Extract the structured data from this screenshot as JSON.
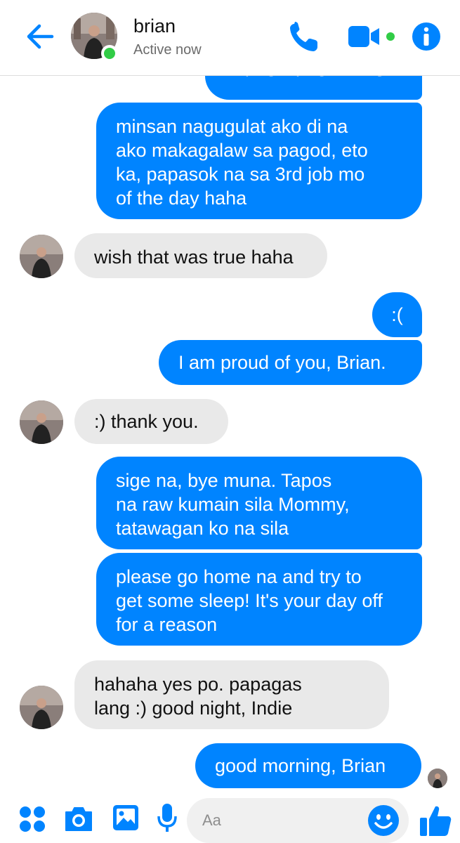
{
  "header": {
    "contact_name": "brian",
    "status": "Active now"
  },
  "messages": [
    {
      "from": "me",
      "text": "sipag sipag mo nga"
    },
    {
      "from": "me",
      "text": "minsan nagugulat ako di na\nako makagalaw sa pagod, eto\nka, papasok na sa 3rd job mo\nof the day haha"
    },
    {
      "from": "brian",
      "text": "wish that was true haha"
    },
    {
      "from": "me",
      "text": ":("
    },
    {
      "from": "me",
      "text": "I am proud of you, Brian."
    },
    {
      "from": "brian",
      "text": ":) thank you."
    },
    {
      "from": "me",
      "text": "sige na, bye muna. Tapos\nna raw kumain sila Mommy,\ntatawagan ko na sila"
    },
    {
      "from": "me",
      "text": "please go home na and try to\nget some sleep! It's your day off\nfor a reason"
    },
    {
      "from": "brian",
      "text": "hahaha yes po. papagas\nlang :) good night, Indie"
    },
    {
      "from": "me",
      "text": "good morning, Brian"
    }
  ],
  "composer": {
    "placeholder": "Aa"
  },
  "icons": {
    "back": "arrow-left-icon",
    "call": "phone-icon",
    "video": "video-camera-icon",
    "info": "info-icon",
    "more": "four-dots-icon",
    "camera": "camera-icon",
    "gallery": "image-icon",
    "voice": "microphone-icon",
    "emoji": "smiley-icon",
    "like": "thumbs-up-icon"
  },
  "colors": {
    "accent": "#0084ff",
    "incoming_bubble": "#e9e9e9",
    "online": "#31cc46"
  }
}
